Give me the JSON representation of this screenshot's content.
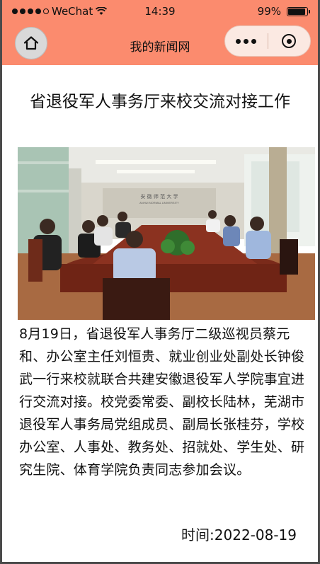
{
  "status_bar": {
    "carrier": "WeChat",
    "time": "14:39",
    "battery": "99%",
    "battery_level": 0.99
  },
  "nav": {
    "title": "我的新闻网"
  },
  "article": {
    "title": "省退役军人事务厅来校交流对接工作",
    "photo_sign": "ANHUI NORMAL UNIVERSITY",
    "body": "8月19日，省退役军人事务厅二级巡视员蔡元和、办公室主任刘恒贵、就业创业处副处长钟俊武一行来校就联合共建安徽退役军人学院事宜进行交流对接。校党委常委、副校长陆林，芜湖市退役军人事务局党组成员、副局长张桂芬，学校办公室、人事处、教务处、招就处、学生处、研究生院、体育学院负责同志参加会议。",
    "date_label": "时间",
    "date_value": "2022-08-19"
  },
  "icons": {
    "home": "home-icon",
    "more": "more-dots-icon",
    "close": "target-icon",
    "wifi": "wifi-icon",
    "battery": "battery-icon"
  },
  "colors": {
    "nav_background": "#fb8b6e"
  }
}
